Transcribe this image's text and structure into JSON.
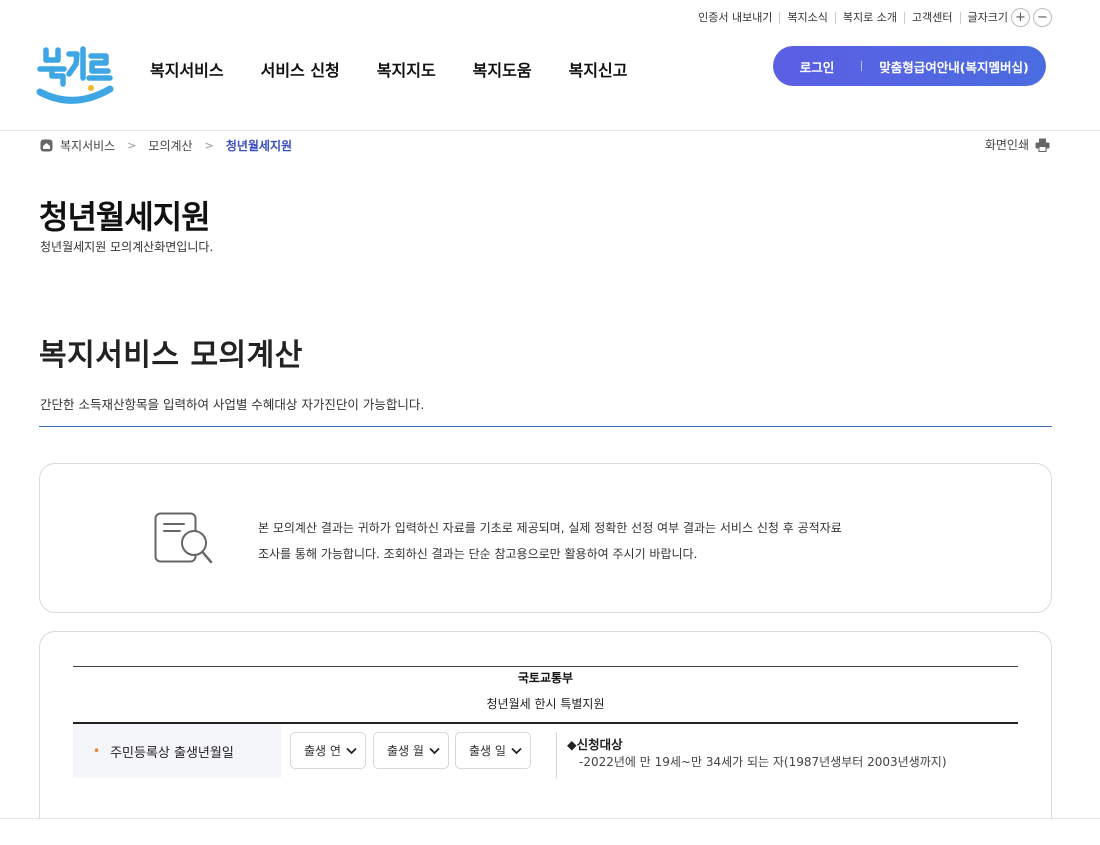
{
  "utility": {
    "links": [
      "인증서 내보내기",
      "복지소식",
      "복지로 소개",
      "고객센터"
    ],
    "font_size_label": "글자크기",
    "font_plus": "+",
    "font_minus": "−"
  },
  "logo": {
    "alt": "복지로",
    "text": "복지로",
    "color": "#4aa8e8"
  },
  "gnb": [
    "복지서비스",
    "서비스 신청",
    "복지지도",
    "복지도움",
    "복지신고"
  ],
  "member": {
    "login": "로그인",
    "guide": "맞춤형급여안내(복지멤버십)"
  },
  "breadcrumb": {
    "items": [
      "복지서비스",
      "모의계산"
    ],
    "current": "청년월세지원"
  },
  "print_label": "화면인쇄",
  "page": {
    "title": "청년월세지원",
    "subtitle": "청년월세지원 모의계산화면입니다."
  },
  "section": {
    "title": "복지서비스 모의계산",
    "desc": "간단한 소득재산항목을 입력하여 사업별 수혜대상 자가진단이 가능합니다."
  },
  "notice": {
    "line1": "본 모의계산 결과는 귀하가 입력하신 자료를 기초로 제공되며, 실제 정확한 선정 여부 결과는 서비스 신청 후 공적자료",
    "line2": "조사를 통해 가능합니다. 조회하신 결과는 단순 참고용으로만 활용하여 주시기 바랍니다."
  },
  "calc": {
    "ministry": "국토교통부",
    "program": "청년월세 한시 특별지원",
    "row_label": "주민등록상 출생년월일",
    "selects": [
      "출생 연",
      "출생 월",
      "출생 일"
    ],
    "eligibility_title": "◆신청대상",
    "eligibility_text": "-2022년에 만 19세~만 34세가 되는 자(1987년생부터 2003년생까지)"
  },
  "colors": {
    "accent": "#3a4ec0",
    "member_gradient_start": "#5b5fe3",
    "bullet": "#f07a2c"
  }
}
